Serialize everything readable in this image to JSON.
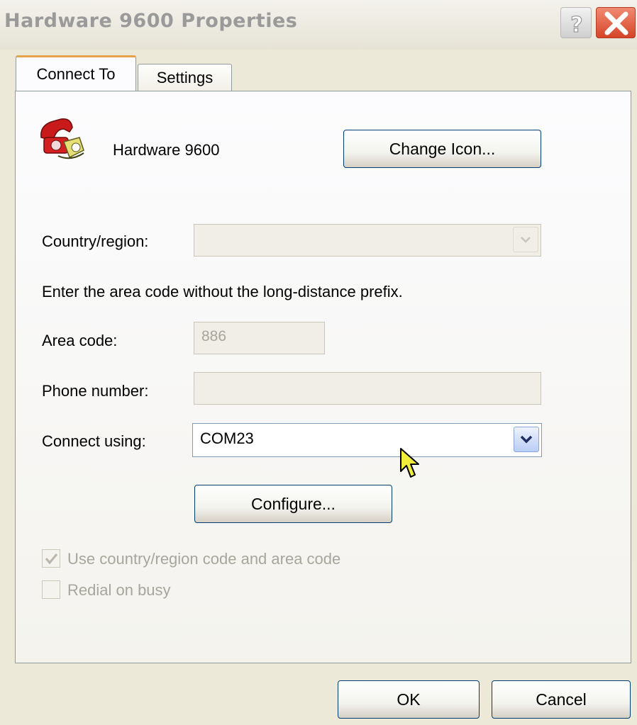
{
  "window": {
    "title": "Hardware 9600 Properties",
    "help_icon": "question-mark-icon",
    "close_icon": "close-x-icon"
  },
  "tabs": [
    {
      "label": "Connect To",
      "active": true
    },
    {
      "label": "Settings",
      "active": false
    }
  ],
  "connection": {
    "icon": "telephone-icon",
    "name": "Hardware 9600",
    "change_icon_label": "Change Icon..."
  },
  "form": {
    "country_label": "Country/region:",
    "country_value": "",
    "instruction": "Enter the area code without the long-distance prefix.",
    "area_code_label": "Area code:",
    "area_code_value": "886",
    "phone_label": "Phone number:",
    "phone_value": "",
    "connect_using_label": "Connect using:",
    "connect_using_value": "COM23",
    "configure_label": "Configure..."
  },
  "checkboxes": [
    {
      "label": "Use country/region code and area code",
      "checked": true,
      "enabled": false
    },
    {
      "label": "Redial on busy",
      "checked": false,
      "enabled": false
    }
  ],
  "footer": {
    "ok_label": "OK",
    "cancel_label": "Cancel"
  },
  "colors": {
    "dialog_bg": "#ece9d8",
    "tab_accent": "#e6a34a",
    "button_border": "#003c74",
    "disabled_text": "#a7a69a"
  }
}
